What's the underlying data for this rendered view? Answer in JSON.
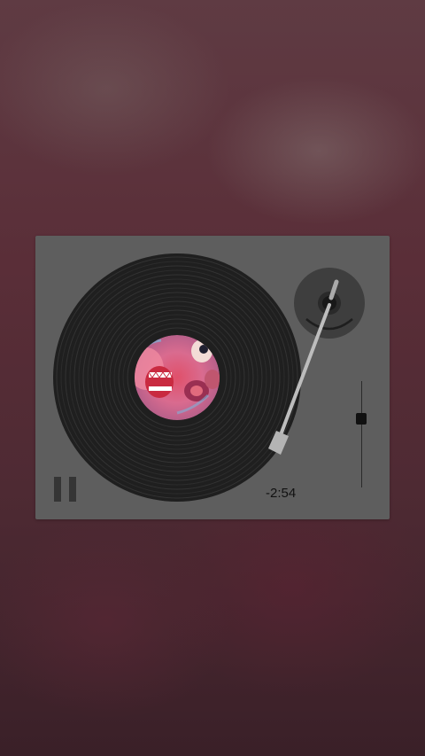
{
  "player": {
    "time_remaining": "-2:54",
    "volume_fraction": 0.65,
    "state": "playing",
    "controls": {
      "pause_icon": "pause-icon"
    }
  },
  "album": {
    "label_art": "face-artwork"
  }
}
